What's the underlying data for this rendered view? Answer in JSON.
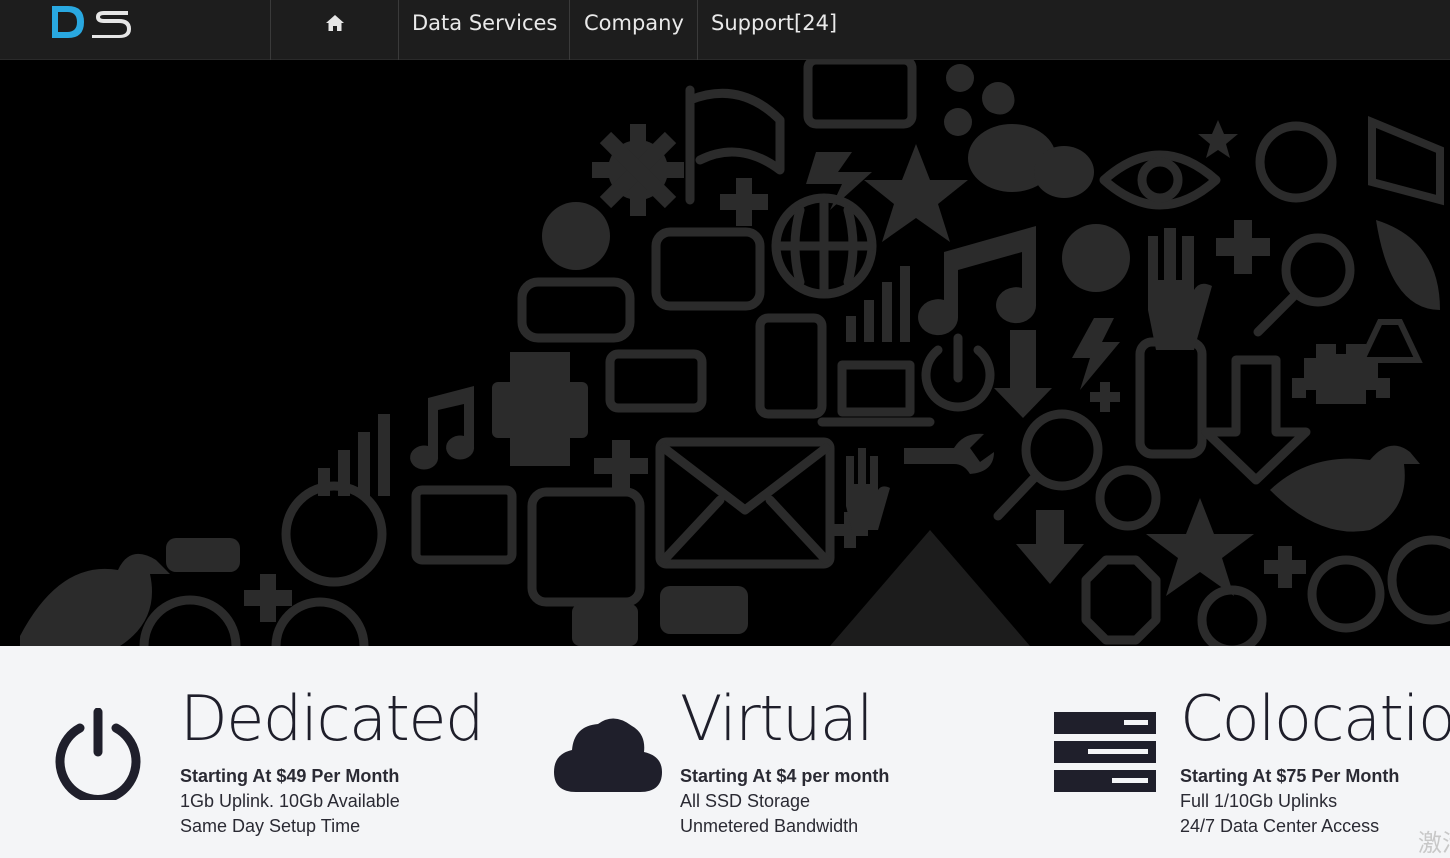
{
  "nav": {
    "logo_text": "DS",
    "home_icon": "home-icon",
    "links": [
      "Data Services",
      "Company",
      "Support[24]"
    ]
  },
  "hero": {
    "background": "#000000",
    "icon_color": "#2a2a2a"
  },
  "services": [
    {
      "icon": "power-icon",
      "title": "Dedicated",
      "price": "Starting At $49 Per Month",
      "lines": [
        "1Gb Uplink. 10Gb Available",
        "Same Day Setup Time"
      ]
    },
    {
      "icon": "cloud-icon",
      "title": "Virtual",
      "price": "Starting At $4 per month",
      "lines": [
        "All SSD Storage",
        "Unmetered Bandwidth"
      ]
    },
    {
      "icon": "server-icon",
      "title": "Colocation",
      "price": "Starting At $75 Per Month",
      "lines": [
        "Full 1/10Gb Uplinks",
        "24/7 Data Center Access"
      ]
    }
  ],
  "watermark": "激活"
}
